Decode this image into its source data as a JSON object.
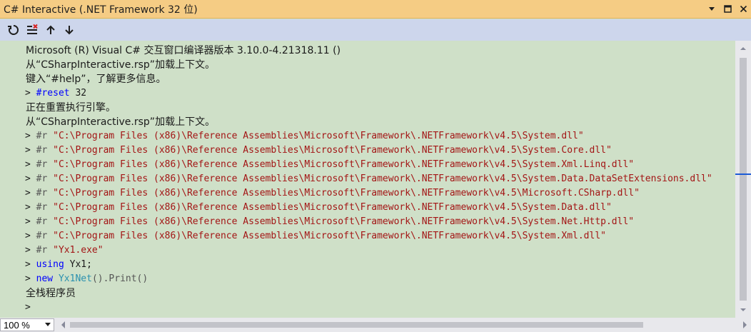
{
  "window": {
    "title": "C# Interactive (.NET Framework 32 位)"
  },
  "toolbar": {
    "icons": [
      "reset-icon",
      "clear-icon",
      "history-up-icon",
      "history-down-icon"
    ]
  },
  "output": {
    "line1": "Microsoft (R) Visual C# 交互窗口编译器版本 3.10.0-4.21318.11 ()",
    "line2": "从“CSharpInteractive.rsp”加载上下文。",
    "line3": "键入“#help”，了解更多信息。",
    "reset_cmd": "#reset",
    "reset_arg": " 32",
    "line5": "正在重置执行引擎。",
    "line6": "从“CSharpInteractive.rsp”加载上下文。",
    "r_directive": "#r",
    "references": [
      "\"C:\\Program Files (x86)\\Reference Assemblies\\Microsoft\\Framework\\.NETFramework\\v4.5\\System.dll\"",
      "\"C:\\Program Files (x86)\\Reference Assemblies\\Microsoft\\Framework\\.NETFramework\\v4.5\\System.Core.dll\"",
      "\"C:\\Program Files (x86)\\Reference Assemblies\\Microsoft\\Framework\\.NETFramework\\v4.5\\System.Xml.Linq.dll\"",
      "\"C:\\Program Files (x86)\\Reference Assemblies\\Microsoft\\Framework\\.NETFramework\\v4.5\\System.Data.DataSetExtensions.dll\"",
      "\"C:\\Program Files (x86)\\Reference Assemblies\\Microsoft\\Framework\\.NETFramework\\v4.5\\Microsoft.CSharp.dll\"",
      "\"C:\\Program Files (x86)\\Reference Assemblies\\Microsoft\\Framework\\.NETFramework\\v4.5\\System.Data.dll\"",
      "\"C:\\Program Files (x86)\\Reference Assemblies\\Microsoft\\Framework\\.NETFramework\\v4.5\\System.Net.Http.dll\"",
      "\"C:\\Program Files (x86)\\Reference Assemblies\\Microsoft\\Framework\\.NETFramework\\v4.5\\System.Xml.dll\""
    ],
    "exe_ref": "\"Yx1.exe\"",
    "using_kw": "using",
    "using_rest": " Yx1;",
    "new_kw": "new",
    "class_name": "Yx1Net",
    "call_rest": "().Print()",
    "result": "全栈程序员",
    "prompt": ">"
  },
  "statusbar": {
    "zoom": "100 %"
  },
  "colors": {
    "title_bg": "#f5cc84",
    "toolbar_bg": "#cdd6ec",
    "editor_bg": "#cfe0c8",
    "keyword": "#0000ff",
    "string": "#a31515",
    "type": "#2b91af"
  }
}
